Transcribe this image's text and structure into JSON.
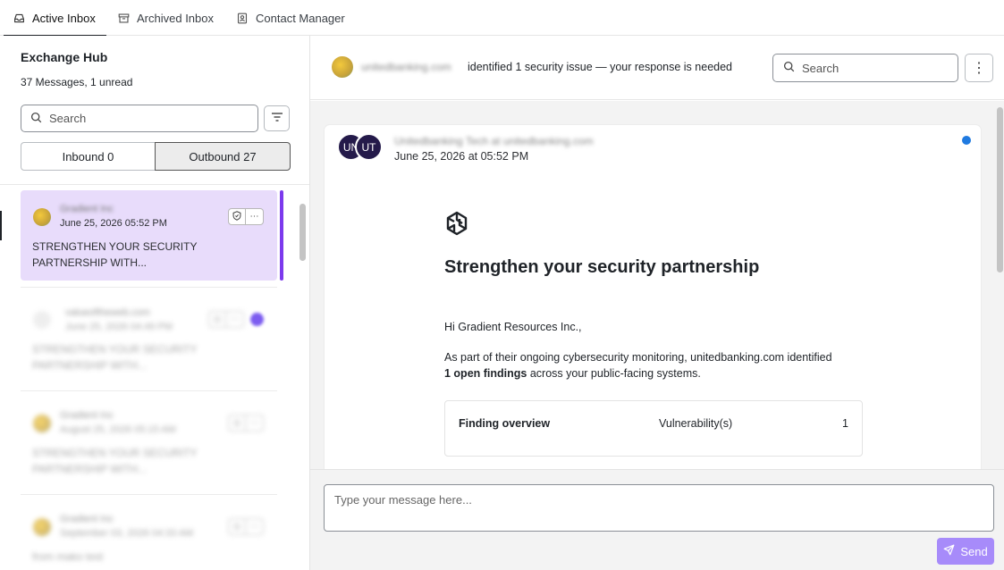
{
  "tabs": [
    {
      "label": "Active Inbox",
      "icon": "inbox-icon",
      "active": true
    },
    {
      "label": "Archived Inbox",
      "icon": "archive-icon",
      "active": false
    },
    {
      "label": "Contact Manager",
      "icon": "contact-card-icon",
      "active": false
    }
  ],
  "sidebar": {
    "title": "Exchange Hub",
    "subtitle": "37 Messages, 1 unread",
    "search_placeholder": "Search",
    "segments": {
      "inbound": "Inbound 0",
      "outbound": "Outbound 27",
      "selected": "outbound"
    },
    "messages": [
      {
        "sender": "Gradient Inc",
        "date": "June 25, 2026 05:52 PM",
        "subject": "STRENGTHEN YOUR SECURITY PARTNERSHIP WITH...",
        "selected": true
      },
      {
        "sender": "valueoftheweb.com",
        "date": "June 25, 2026 04:49 PM",
        "subject": "STRENGTHEN YOUR SECURITY PARTNERSHIP WITH...",
        "selected": false
      },
      {
        "sender": "Gradient Inc",
        "date": "August 25, 2026 05:15 AM",
        "subject": "STRENGTHEN YOUR SECURITY PARTNERSHIP WITH...",
        "selected": false
      },
      {
        "sender": "Gradient Inc",
        "date": "September 03, 2026 04:33 AM",
        "subject": "from mako test",
        "selected": false
      }
    ]
  },
  "conversation": {
    "header_domain": "unitedbanking.com",
    "header_text": "identified 1 security issue — your response is needed",
    "search_placeholder": "Search",
    "more_label": "⋮"
  },
  "email": {
    "avatars": [
      "UN",
      "UT"
    ],
    "from": "Unitedbanking Tech at unitedbanking.com",
    "date": "June 25, 2026 at 05:52 PM",
    "title": "Strengthen your security partnership",
    "greeting": "Hi Gradient Resources Inc.,",
    "body_prefix": "As part of their ongoing cybersecurity monitoring, unitedbanking.com identified ",
    "body_bold": "1 open findings",
    "body_suffix": " across your public-facing systems.",
    "findings": {
      "title": "Finding overview",
      "label": "Vulnerability(s)",
      "count": "1"
    }
  },
  "composer": {
    "placeholder": "Type your message here...",
    "send_label": "Send"
  },
  "colors": {
    "accent": "#7c3aed",
    "selected_bg": "#e8dcfb",
    "send_button": "#a78bfa",
    "avatar_dark": "#241a4a",
    "unread_dot": "#1f7ae0"
  }
}
